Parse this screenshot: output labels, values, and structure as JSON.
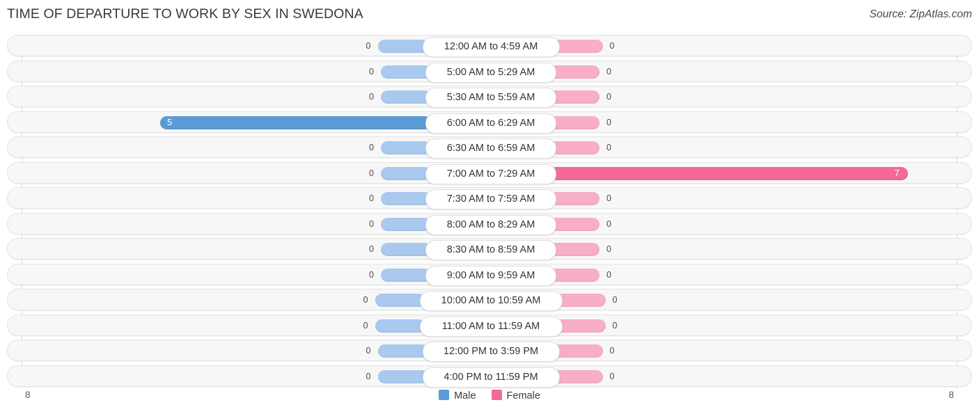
{
  "header": {
    "title": "TIME OF DEPARTURE TO WORK BY SEX IN SWEDONA",
    "source": "Source: ZipAtlas.com"
  },
  "legend": {
    "items": [
      {
        "label": "Male",
        "color": "#5b9bd5"
      },
      {
        "label": "Female",
        "color": "#f4689b"
      }
    ]
  },
  "axis": {
    "left_tick": "8",
    "right_tick": "8"
  },
  "colors": {
    "male": "#5b9bd5",
    "male_zero": "#a9c9ef",
    "female": "#f4689b",
    "female_zero": "#f8aec8",
    "row_background": "#f7f7f7",
    "row_border": "#e3e3e3",
    "gridline": "#d9d9d9"
  },
  "chart_data": {
    "type": "bar",
    "title": "TIME OF DEPARTURE TO WORK BY SEX IN SWEDONA",
    "subtitle": "Source: ZipAtlas.com",
    "orientation": "horizontal",
    "layout": "diverging-bidirectional",
    "xlabel": "",
    "ylabel": "",
    "xlim": [
      8,
      8
    ],
    "axis_max": 8,
    "grid": false,
    "legend_position": "bottom-center",
    "categories": [
      "12:00 AM to 4:59 AM",
      "5:00 AM to 5:29 AM",
      "5:30 AM to 5:59 AM",
      "6:00 AM to 6:29 AM",
      "6:30 AM to 6:59 AM",
      "7:00 AM to 7:29 AM",
      "7:30 AM to 7:59 AM",
      "8:00 AM to 8:29 AM",
      "8:30 AM to 8:59 AM",
      "9:00 AM to 9:59 AM",
      "10:00 AM to 10:59 AM",
      "11:00 AM to 11:59 AM",
      "12:00 PM to 3:59 PM",
      "4:00 PM to 11:59 PM"
    ],
    "series": [
      {
        "name": "Male",
        "direction": "left",
        "values": [
          0,
          0,
          0,
          5,
          0,
          0,
          0,
          0,
          0,
          0,
          0,
          0,
          0,
          0
        ]
      },
      {
        "name": "Female",
        "direction": "right",
        "values": [
          0,
          0,
          0,
          0,
          0,
          7,
          0,
          0,
          0,
          0,
          0,
          0,
          0,
          0
        ]
      }
    ]
  },
  "rows": [
    {
      "label": "12:00 AM to 4:59 AM",
      "male": "0",
      "female": "0"
    },
    {
      "label": "5:00 AM to 5:29 AM",
      "male": "0",
      "female": "0"
    },
    {
      "label": "5:30 AM to 5:59 AM",
      "male": "0",
      "female": "0"
    },
    {
      "label": "6:00 AM to 6:29 AM",
      "male": "5",
      "female": "0"
    },
    {
      "label": "6:30 AM to 6:59 AM",
      "male": "0",
      "female": "0"
    },
    {
      "label": "7:00 AM to 7:29 AM",
      "male": "0",
      "female": "7"
    },
    {
      "label": "7:30 AM to 7:59 AM",
      "male": "0",
      "female": "0"
    },
    {
      "label": "8:00 AM to 8:29 AM",
      "male": "0",
      "female": "0"
    },
    {
      "label": "8:30 AM to 8:59 AM",
      "male": "0",
      "female": "0"
    },
    {
      "label": "9:00 AM to 9:59 AM",
      "male": "0",
      "female": "0"
    },
    {
      "label": "10:00 AM to 10:59 AM",
      "male": "0",
      "female": "0"
    },
    {
      "label": "11:00 AM to 11:59 AM",
      "male": "0",
      "female": "0"
    },
    {
      "label": "12:00 PM to 3:59 PM",
      "male": "0",
      "female": "0"
    },
    {
      "label": "4:00 PM to 11:59 PM",
      "male": "0",
      "female": "0"
    }
  ]
}
